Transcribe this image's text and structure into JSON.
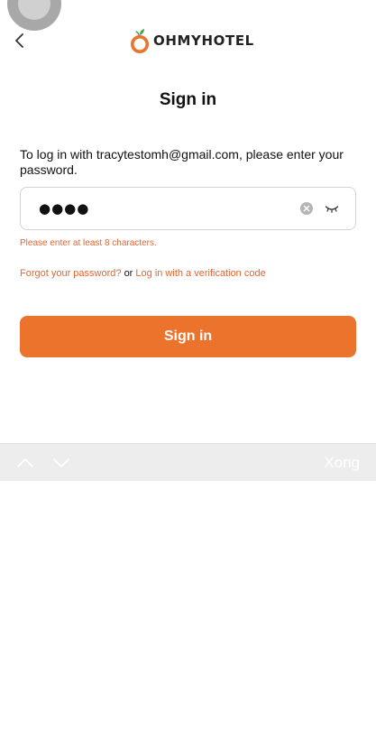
{
  "header": {
    "logo_text": "OHMYHOTEL",
    "brand_color": "#ec732c"
  },
  "page": {
    "title": "Sign in",
    "instruction": "To log in with tracytestomh@gmail.com, please enter your password."
  },
  "password_field": {
    "value": "●●●●",
    "clear_icon": "clear-circle-icon",
    "visibility_icon": "eye-closed-icon"
  },
  "error": {
    "message": "Please enter at least 8 characters.",
    "color": "#e8642c"
  },
  "links": {
    "forgot_password": "Forgot your password?",
    "or": "or",
    "verification_code": "Log in with a verification code"
  },
  "actions": {
    "signin_label": "Sign in"
  },
  "keyboard_toolbar": {
    "done_label": "Xong"
  }
}
